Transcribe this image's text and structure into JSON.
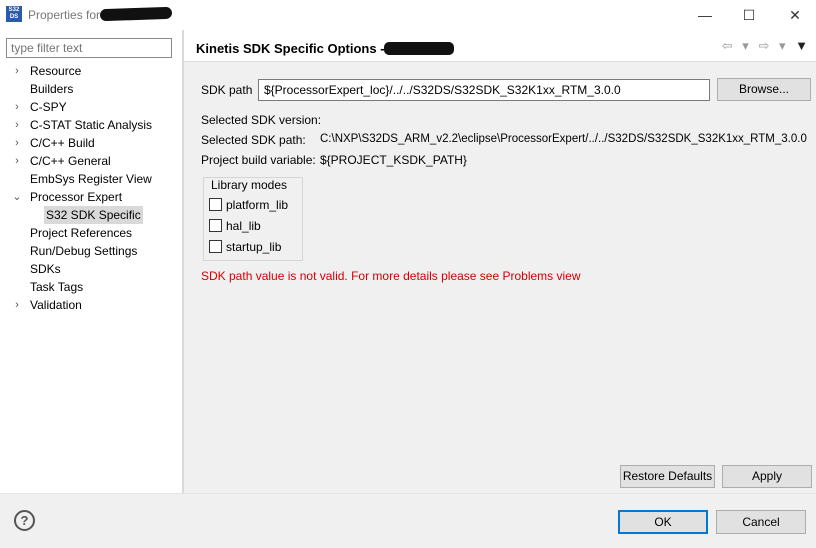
{
  "window": {
    "title": "Properties for",
    "app_icon_text": "S32 DS",
    "minimize_glyph": "—",
    "maximize_glyph": "☐",
    "close_glyph": "✕"
  },
  "sidebar": {
    "filter_placeholder": "type filter text",
    "items": [
      {
        "label": "Resource",
        "expander": "›"
      },
      {
        "label": "Builders",
        "expander": ""
      },
      {
        "label": "C-SPY",
        "expander": "›"
      },
      {
        "label": "C-STAT Static Analysis",
        "expander": "›"
      },
      {
        "label": "C/C++ Build",
        "expander": "›"
      },
      {
        "label": "C/C++ General",
        "expander": "›"
      },
      {
        "label": "EmbSys Register View",
        "expander": ""
      },
      {
        "label": "Processor Expert",
        "expander": "⌄"
      },
      {
        "label": "S32 SDK Specific",
        "expander": ""
      },
      {
        "label": "Project References",
        "expander": ""
      },
      {
        "label": "Run/Debug Settings",
        "expander": ""
      },
      {
        "label": "SDKs",
        "expander": ""
      },
      {
        "label": "Task Tags",
        "expander": ""
      },
      {
        "label": "Validation",
        "expander": "›"
      }
    ]
  },
  "page": {
    "title": "Kinetis SDK Specific Options -",
    "nav": {
      "back": "⇦",
      "back_menu": "▾",
      "forward": "⇨",
      "forward_menu": "▾",
      "view_menu": "▼"
    },
    "sdk_path_label": "SDK path",
    "sdk_path_value": "${ProcessorExpert_loc}/../../S32DS/S32SDK_S32K1xx_RTM_3.0.0",
    "browse_label": "Browse...",
    "selected_version_label": "Selected SDK version:",
    "selected_version_value": "",
    "selected_path_label": "Selected SDK path:",
    "selected_path_value": "C:\\NXP\\S32DS_ARM_v2.2\\eclipse\\ProcessorExpert/../../S32DS/S32SDK_S32K1xx_RTM_3.0.0",
    "build_variable_label": "Project build variable:",
    "build_variable_value": "${PROJECT_KSDK_PATH}",
    "library_modes": {
      "title": "Library modes",
      "options": [
        {
          "label": "platform_lib",
          "checked": false
        },
        {
          "label": "hal_lib",
          "checked": false
        },
        {
          "label": "startup_lib",
          "checked": false
        }
      ]
    },
    "error_message": "SDK path value is not valid. For more details please see Problems view",
    "restore_defaults_label": "Restore Defaults",
    "apply_label": "Apply"
  },
  "footer": {
    "help_glyph": "?",
    "ok_label": "OK",
    "cancel_label": "Cancel"
  },
  "colors": {
    "error": "#d40000",
    "focus_border": "#0078d7",
    "selection": "#d9d9d9"
  }
}
